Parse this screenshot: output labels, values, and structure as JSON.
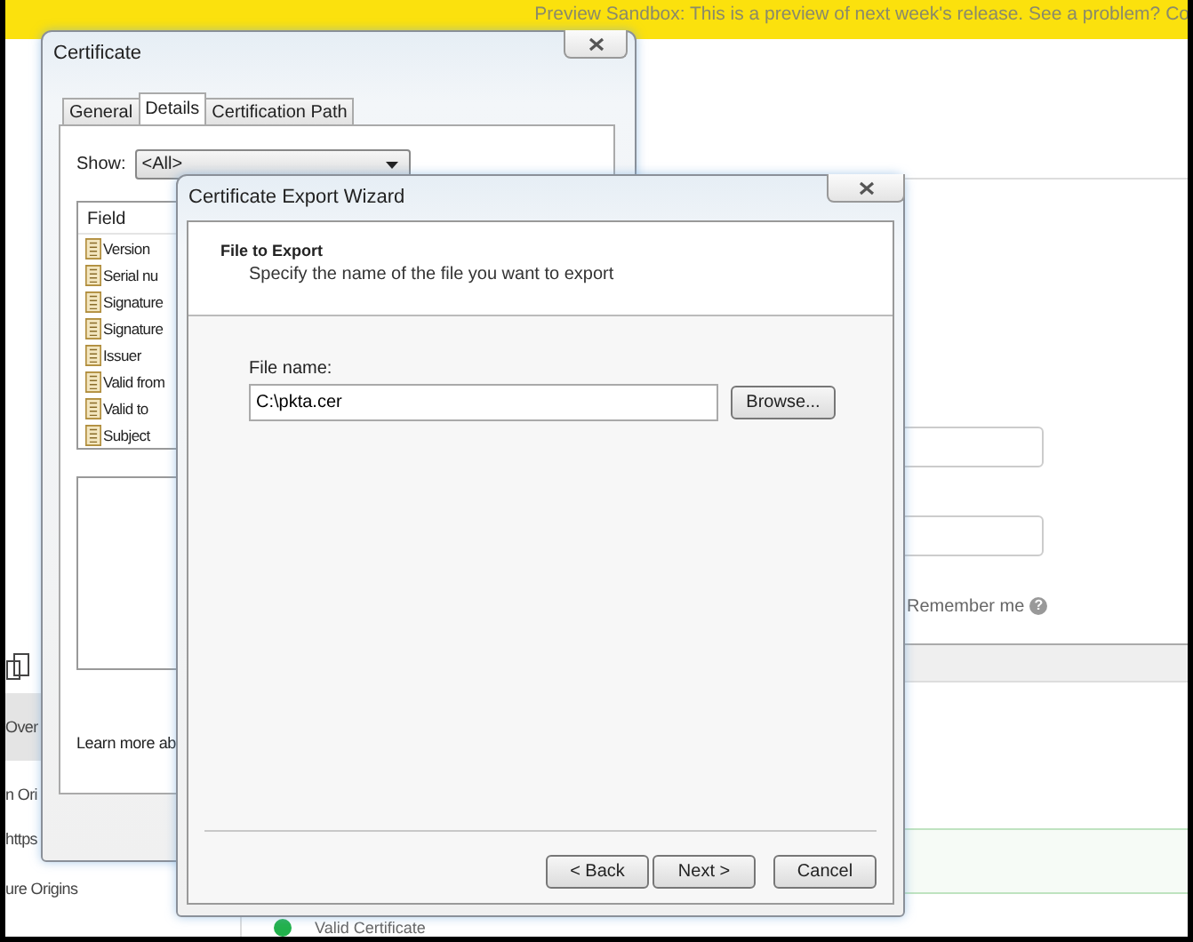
{
  "banner": {
    "text": "Preview Sandbox: This is a preview of next week's release. See a problem? Co"
  },
  "sidebar": {
    "items": [
      {
        "label": "Over",
        "selected": true
      },
      {
        "label": "n Ori",
        "selected": false
      },
      {
        "label": "https",
        "selected": false
      },
      {
        "label": "ure Origins",
        "selected": false
      }
    ]
  },
  "login": {
    "remember_label": "Remember me",
    "help": "?"
  },
  "status": {
    "label": "Valid Certificate"
  },
  "certificate_window": {
    "title": "Certificate",
    "tabs": [
      {
        "label": "General",
        "selected": false
      },
      {
        "label": "Details",
        "selected": true
      },
      {
        "label": "Certification Path",
        "selected": false
      }
    ],
    "show_label": "Show:",
    "show_value": "<All>",
    "list_header": "Field",
    "fields": [
      "Version",
      "Serial nu",
      "Signature",
      "Signature",
      "Issuer",
      "Valid from",
      "Valid to",
      "Subject"
    ],
    "learn_more": "Learn more ab"
  },
  "wizard": {
    "title": "Certificate Export Wizard",
    "heading": "File to Export",
    "subheading": "Specify the name of the file you want to export",
    "file_label": "File name:",
    "file_value": "C:\\pkta.cer",
    "browse": "Browse...",
    "buttons": [
      {
        "label": "< Back"
      },
      {
        "label": "Next >"
      },
      {
        "label": "Cancel"
      }
    ]
  }
}
